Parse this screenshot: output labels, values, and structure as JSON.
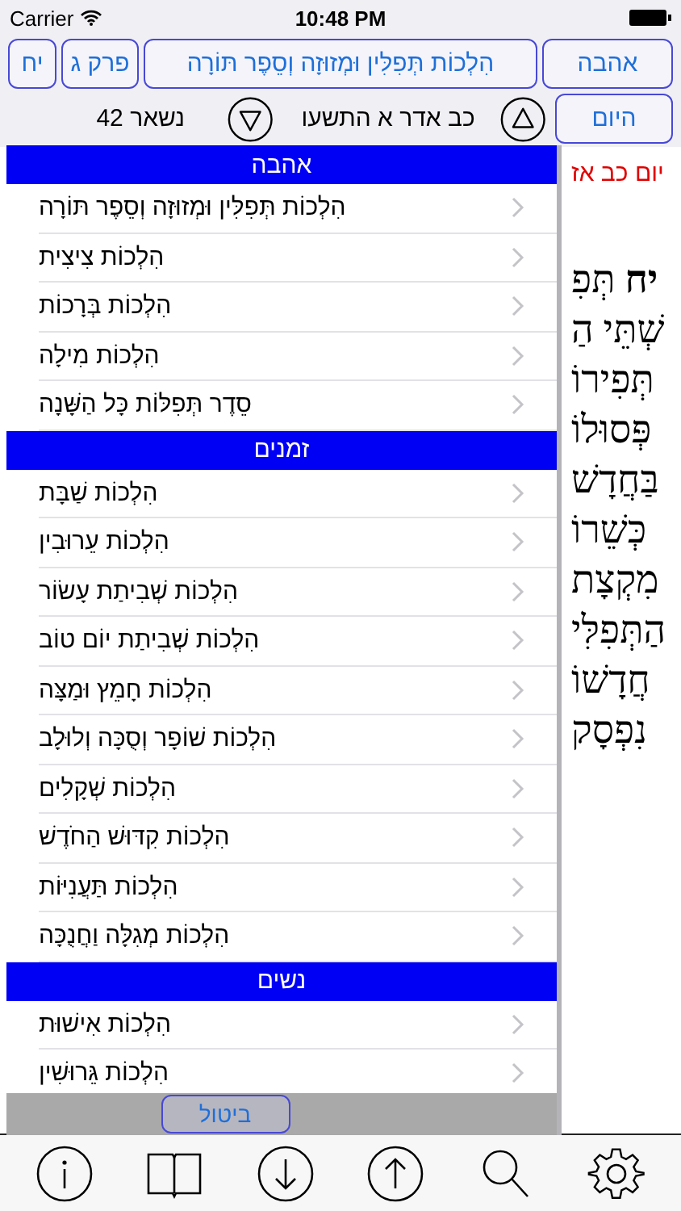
{
  "status_bar": {
    "carrier": "Carrier",
    "time": "10:48 PM"
  },
  "nav": {
    "halacha_button": "יח",
    "chapter_button": "פרק ג",
    "title_button": "הִלְכוֹת תְּפִלִּין וּמְזוּזָה וְסֵפֶר תּוֹרָה",
    "book_button": "אהבה",
    "remaining": "נשאר 42",
    "date": "כב אדר א התשעו",
    "today_button": "היום"
  },
  "menu": {
    "sections": [
      {
        "title": "אהבה",
        "items": [
          {
            "label": "הִלְכוֹת תְּפִלִּין וּמְזוּזָה וְסֵפֶר תּוֹרָה"
          },
          {
            "label": "הִלְכוֹת צִיצִית"
          },
          {
            "label": "הִלְכוֹת בְּרָכוֹת"
          },
          {
            "label": "הִלְכוֹת מִילָה"
          },
          {
            "label": "סֵדֶר תְּפִלּוֹת כָּל הַשָּׁנָה"
          }
        ]
      },
      {
        "title": "זמנים",
        "items": [
          {
            "label": "הִלְכוֹת שַׁבָּת"
          },
          {
            "label": "הִלְכוֹת עֵרוּבִין"
          },
          {
            "label": "הִלְכוֹת שְׁבִיתַת עָשׂוֹר"
          },
          {
            "label": "הִלְכוֹת שְׁבִיתַת יוֹם טוֹב"
          },
          {
            "label": "הִלְכוֹת חָמֵץ וּמַצָּה"
          },
          {
            "label": "הִלְכוֹת שׁוֹפָר וְסֻכָּה וְלוּלָב"
          },
          {
            "label": "הִלְכוֹת שְׁקָלִים"
          },
          {
            "label": "הִלְכוֹת קִדּוּשׁ הַחֹדֶשׁ"
          },
          {
            "label": "הִלְכוֹת תַּעֲנִיּוֹת"
          },
          {
            "label": "הִלְכוֹת מְגִלָּה וַחֲנֻכָּה"
          }
        ]
      },
      {
        "title": "נשים",
        "items": [
          {
            "label": "הִלְכוֹת אִישׁוּת"
          },
          {
            "label": "הִלְכוֹת גֵּרוּשִׁין"
          }
        ]
      }
    ],
    "cancel": "ביטול"
  },
  "reading": {
    "day_line": "יום כב אז",
    "lines": [
      "**יח** תְּפִ",
      "שְׁתֵּי הַ",
      "תְּפִירוֹ",
      "פְּסוּלוֹ",
      "בַּחֲדָשׁ",
      "כְּשֵׁרוֹ",
      "מִקְצָת",
      "הַתְּפִלִּי",
      "חֲדָשׁוֹ",
      "נִפְסָק"
    ]
  }
}
